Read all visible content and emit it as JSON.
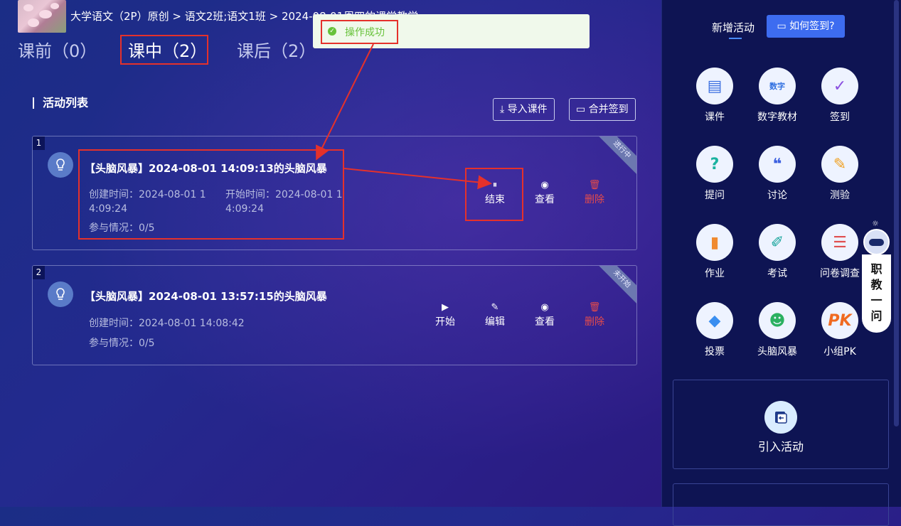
{
  "header": {
    "breadcrumb": "大学语文（2P）原创 > 语文2班;语文1班 > 2024-08-01周四的课堂教学"
  },
  "tabs": [
    {
      "label": "课前（0）",
      "active": false
    },
    {
      "label": "课中（2）",
      "active": true
    },
    {
      "label": "课后（2）",
      "active": false
    }
  ],
  "toast": {
    "message": "操作成功"
  },
  "list": {
    "title": "活动列表",
    "import_label": "导入课件",
    "merge_label": "合并签到"
  },
  "activities": [
    {
      "index": "1",
      "status": "进行中",
      "title": "【头脑风暴】2024-08-01 14:09:13的头脑风暴",
      "created_line1": "创建时间：2024-08-01 1",
      "created_line2": "4:09:24",
      "start_line1": "开始时间：2024-08-01 1",
      "start_line2": "4:09:24",
      "participation": "参与情况：0/5",
      "actions": {
        "end": "结束",
        "view": "查看",
        "delete": "删除"
      }
    },
    {
      "index": "2",
      "status": "未开始",
      "title": "【头脑风暴】2024-08-01 13:57:15的头脑风暴",
      "created": "创建时间：2024-08-01 14:08:42",
      "participation": "参与情况：0/5",
      "actions": {
        "start": "开始",
        "edit": "编辑",
        "view": "查看",
        "delete": "删除"
      }
    }
  ],
  "panel": {
    "title": "新增活动",
    "how_label": "如何签到?",
    "items": [
      {
        "label": "课件",
        "icon": "courseware-icon"
      },
      {
        "label": "数字教材",
        "icon": "digital-textbook-icon",
        "badge": "数字"
      },
      {
        "label": "签到",
        "icon": "checkin-icon"
      },
      {
        "label": "提问",
        "icon": "question-icon",
        "badge": "?"
      },
      {
        "label": "讨论",
        "icon": "discussion-icon"
      },
      {
        "label": "测验",
        "icon": "quiz-icon"
      },
      {
        "label": "作业",
        "icon": "homework-icon"
      },
      {
        "label": "考试",
        "icon": "exam-icon"
      },
      {
        "label": "问卷调查",
        "icon": "survey-icon"
      },
      {
        "label": "投票",
        "icon": "vote-icon"
      },
      {
        "label": "头脑风暴",
        "icon": "brainstorm-icon"
      },
      {
        "label": "小组PK",
        "icon": "group-pk-icon",
        "badge": "PK"
      }
    ],
    "import_activity": "引入活动"
  },
  "assistant": {
    "label_chars": [
      "职",
      "教",
      "一",
      "问"
    ]
  },
  "colors": {
    "accent": "#3d6cf0",
    "danger": "#e54b4b",
    "success": "#67c23a",
    "annotation": "#e5312b"
  }
}
